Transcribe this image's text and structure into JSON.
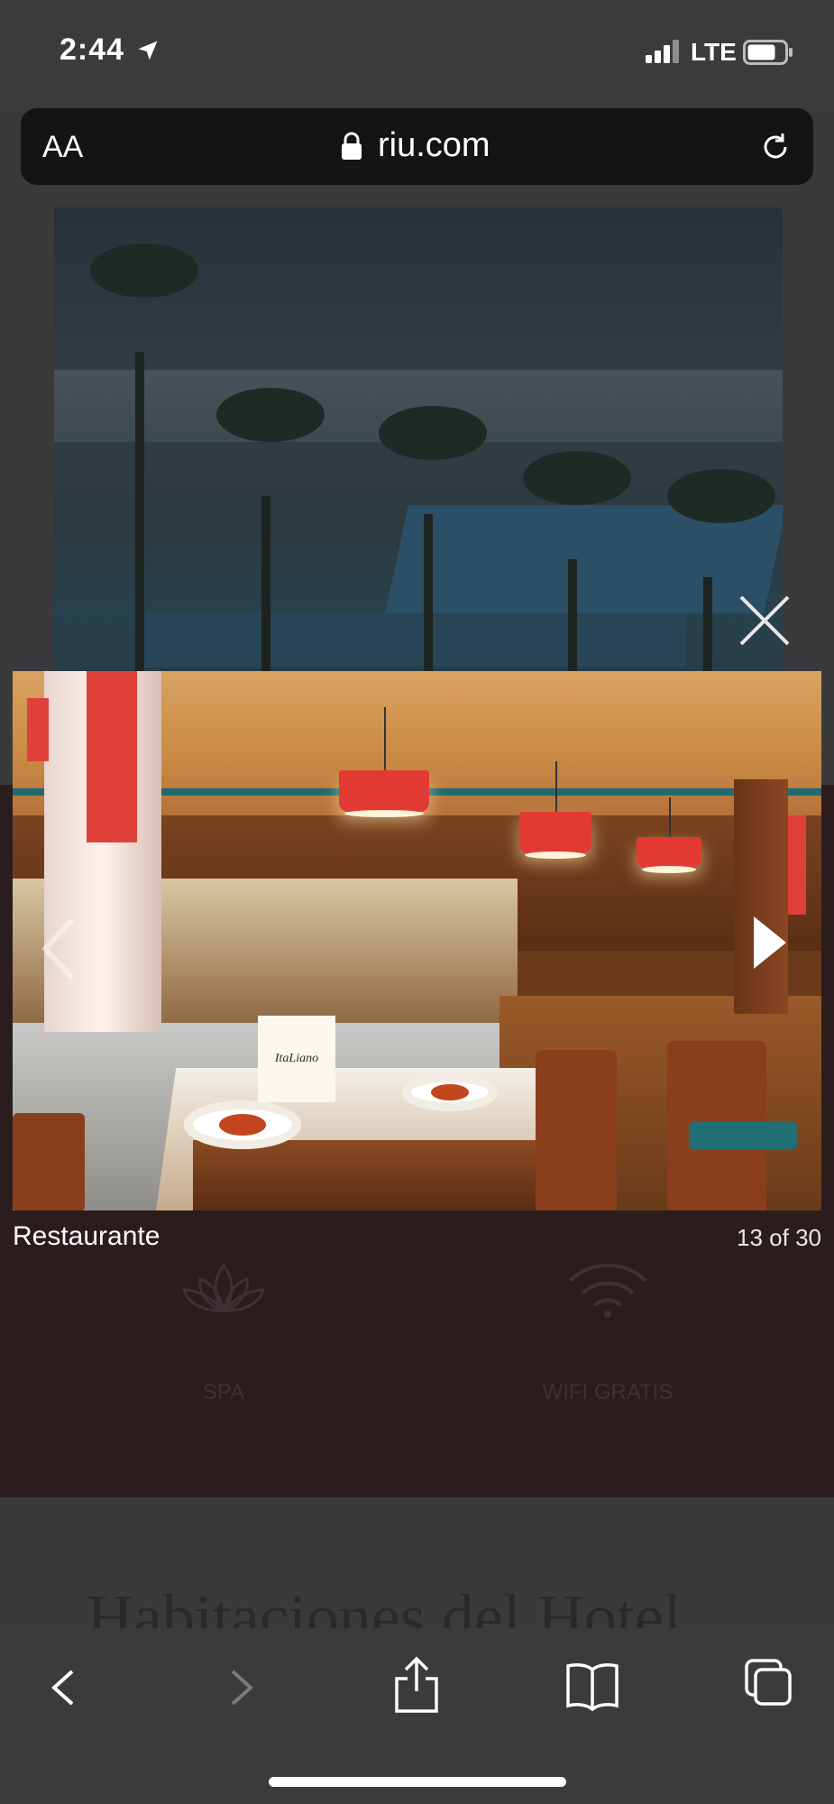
{
  "status_bar": {
    "time": "2:44",
    "network": "LTE",
    "icons": [
      "location-arrow-icon",
      "signal-bars-icon",
      "battery-icon"
    ]
  },
  "address_bar": {
    "text_size_label": "AA",
    "url": "riu.com",
    "icons": [
      "lock-icon",
      "reload-icon"
    ]
  },
  "page": {
    "amenities": [
      {
        "icon": "lotus-icon",
        "label": "SPA"
      },
      {
        "icon": "wifi-icon",
        "label": "WIFI GRATIS"
      }
    ],
    "rooms_heading": "Habitaciones del Hotel"
  },
  "lightbox": {
    "caption": "Restaurante",
    "counter": "13 of 30",
    "menu_card_text": "ItaLiano",
    "icons": [
      "close-icon",
      "chevron-left-icon",
      "chevron-right-icon"
    ]
  },
  "toolbar": {
    "buttons": [
      "back-icon",
      "forward-icon",
      "share-icon",
      "bookmarks-icon",
      "tabs-icon"
    ]
  },
  "colors": {
    "overlay_bg": "#3a3a3c",
    "dark_section": "#2b1d1e",
    "lamp_red": "#e23a32"
  }
}
